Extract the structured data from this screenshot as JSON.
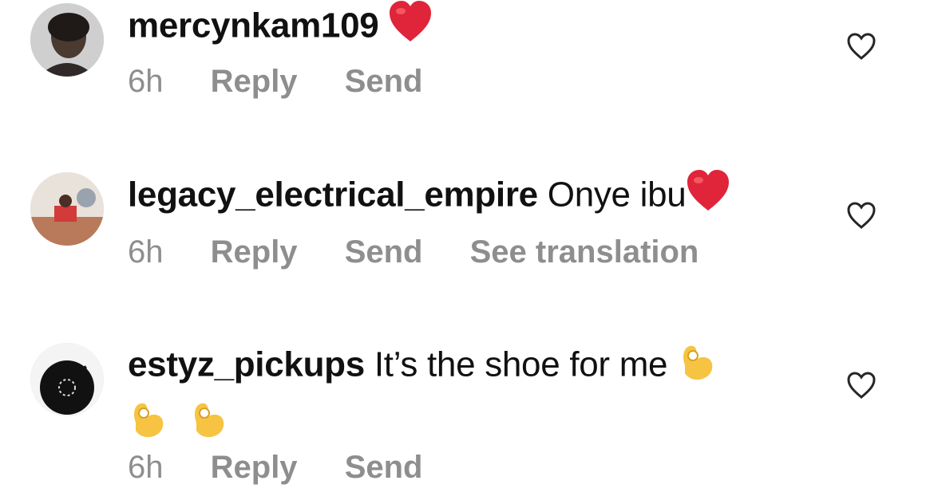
{
  "comments": [
    {
      "username": "mercynkam109",
      "text": "",
      "time": "6h",
      "reply": "Reply",
      "send": "Send",
      "translation": ""
    },
    {
      "username": "legacy_electrical_empire",
      "text": "Onye ibu",
      "time": "6h",
      "reply": "Reply",
      "send": "Send",
      "translation": "See translation"
    },
    {
      "username": "estyz_pickups",
      "text": "It’s the shoe for me",
      "time": "6h",
      "reply": "Reply",
      "send": "Send",
      "translation": ""
    }
  ],
  "icons": {
    "heart_outline": "heart-outline-icon",
    "red_heart_emoji": "red-heart-emoji",
    "ok_hand_emoji": "ok-hand-emoji"
  },
  "colors": {
    "meta_text": "#8e8e8e",
    "primary_text": "#111111",
    "heart_red": "#e0243a",
    "ok_yellow": "#f6c343"
  }
}
